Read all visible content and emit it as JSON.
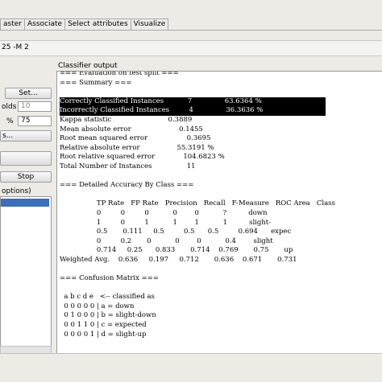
{
  "tabs": [
    "aster",
    "Associate",
    "Select attributes",
    "Visualize"
  ],
  "command_line": "25 -M 2",
  "left": {
    "set_button": "Set...",
    "folds_label": "olds",
    "folds_value": "10",
    "percent_label": "%",
    "percent_value": "75",
    "more_options_button": "s...",
    "stop_button": "Stop",
    "result_list_title": "options)"
  },
  "output": {
    "title": "Classifier output",
    "lines": [
      "=== Evaluation on test split ===",
      "=== Summary ===",
      "",
      "Correctly Classified Instances           7               63.6364 %",
      "Incorrectly Classified Instances         4               36.3636 %",
      "Kappa statistic                          0.3889",
      "Mean absolute error                      0.1455",
      "Root mean squared error                  0.3695",
      "Relative absolute error                 55.3191 %",
      "Root relative squared error             104.6823 %",
      "Total Number of Instances                11",
      "",
      "=== Detailed Accuracy By Class ===",
      "",
      "                 TP Rate   FP Rate   Precision   Recall   F-Measure   ROC Area   Class",
      "                 0         0         0           0        0           ?          down",
      "                 1         0         1           1        1           1          slight-",
      "                 0.5       0.111     0.5         0.5      0.5         0.694      expec",
      "                 0         0.2       0           0        0           0.4        slight",
      "                 0.714     0.25      0.833       0.714    0.769       0.75       up",
      "Weighted Avg.    0.636     0.197     0.712       0.636    0.671       0.731",
      "",
      "=== Confusion Matrix ===",
      "",
      "  a b c d e   <-- classified as",
      "  0 0 0 0 0 | a = down",
      "  0 1 0 0 0 | b = slight-down",
      "  0 0 1 1 0 | c = expected",
      "  0 0 0 0 1 | d = slight-up"
    ]
  }
}
